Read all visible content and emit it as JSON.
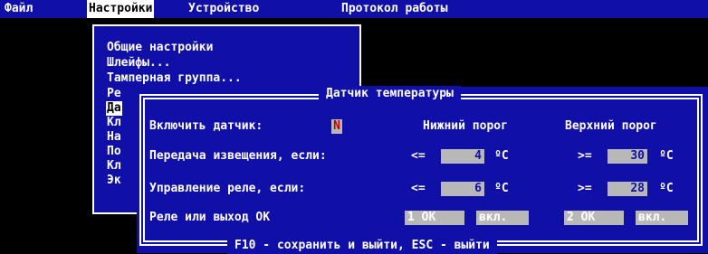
{
  "menubar": {
    "items": [
      {
        "label": "Файл"
      },
      {
        "label": "Настройки"
      },
      {
        "label": "Устройство"
      },
      {
        "label": "Протокол работы"
      }
    ]
  },
  "dropdown": {
    "items": [
      "Общие настройки",
      "Шлейфы...",
      "Тамперная группа...",
      "Ре",
      "Да",
      "Кл",
      "На",
      "По",
      "Кл",
      "Эк"
    ]
  },
  "dialog": {
    "title": "Датчик температуры",
    "footer": "F10 - сохранить и выйти, ESC - выйти",
    "enable_label": "Включить датчик:",
    "enable_value": "N",
    "lower_header": "Нижний порог",
    "upper_header": "Верхний порог",
    "rows": [
      {
        "label": "Передача извещения, если:",
        "lower_op": "<=",
        "lower_value": "4",
        "upper_op": ">=",
        "upper_value": "30",
        "unit": "ºС"
      },
      {
        "label": "Управление реле, если:",
        "lower_op": "<=",
        "lower_value": "6",
        "upper_op": ">=",
        "upper_value": "28",
        "unit": "ºС"
      }
    ],
    "relay_label": "Реле или выход ОК",
    "relay_lower": "1 ОК",
    "relay_lower_btn": "вкл.",
    "relay_upper": "2 ОК",
    "relay_upper_btn": "вкл."
  },
  "colors": {
    "background": "#000000",
    "panel": "#1010a8",
    "field": "#b8b8b8",
    "text": "#ffffff",
    "checkbox_mark": "#c00000"
  }
}
